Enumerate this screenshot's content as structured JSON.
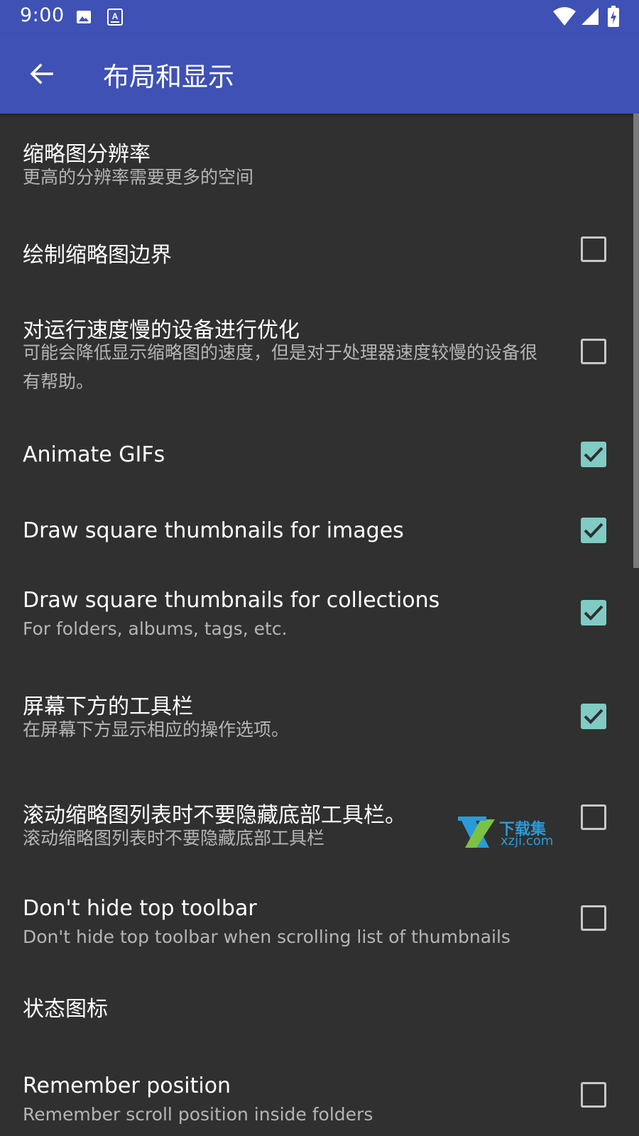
{
  "status_bar": {
    "time": "9:00",
    "icons": [
      "image-icon",
      "text-icon",
      "wifi-icon",
      "signal-icon",
      "battery-charging-icon"
    ]
  },
  "app_bar": {
    "back_icon": "arrow-left-icon",
    "title": "布局和显示"
  },
  "preferences": [
    {
      "title": "缩略图分辨率",
      "summary": "更高的分辨率需要更多的空间"
    },
    {
      "title": "绘制缩略图边界",
      "checked": false
    },
    {
      "title": "对运行速度慢的设备进行优化",
      "summary": "可能会降低显示缩略图的速度，但是对于处理器速度较慢的设备很有帮助。",
      "checked": false
    },
    {
      "title": "Animate GIFs",
      "checked": true
    },
    {
      "title": "Draw square thumbnails for images",
      "checked": true
    },
    {
      "title": "Draw square thumbnails for collections",
      "summary": "For folders, albums, tags, etc.",
      "checked": true
    },
    {
      "title": "屏幕下方的工具栏",
      "summary": "在屏幕下方显示相应的操作选项。",
      "checked": true
    },
    {
      "title": "滚动缩略图列表时不要隐藏底部工具栏。",
      "summary": "滚动缩略图列表时不要隐藏底部工具栏",
      "checked": false
    },
    {
      "title": "Don't hide top toolbar",
      "summary": "Don't hide top toolbar when scrolling list of thumbnails",
      "checked": false
    },
    {
      "section": "状态图标"
    },
    {
      "title": "Remember position",
      "summary": "Remember scroll position inside folders",
      "checked": false
    }
  ],
  "watermark": {
    "text_top": "下载集",
    "text_bottom": "xzji.com"
  },
  "colors": {
    "primary": "#3f51b5",
    "background": "#303030",
    "accent": "#80cbc4"
  }
}
